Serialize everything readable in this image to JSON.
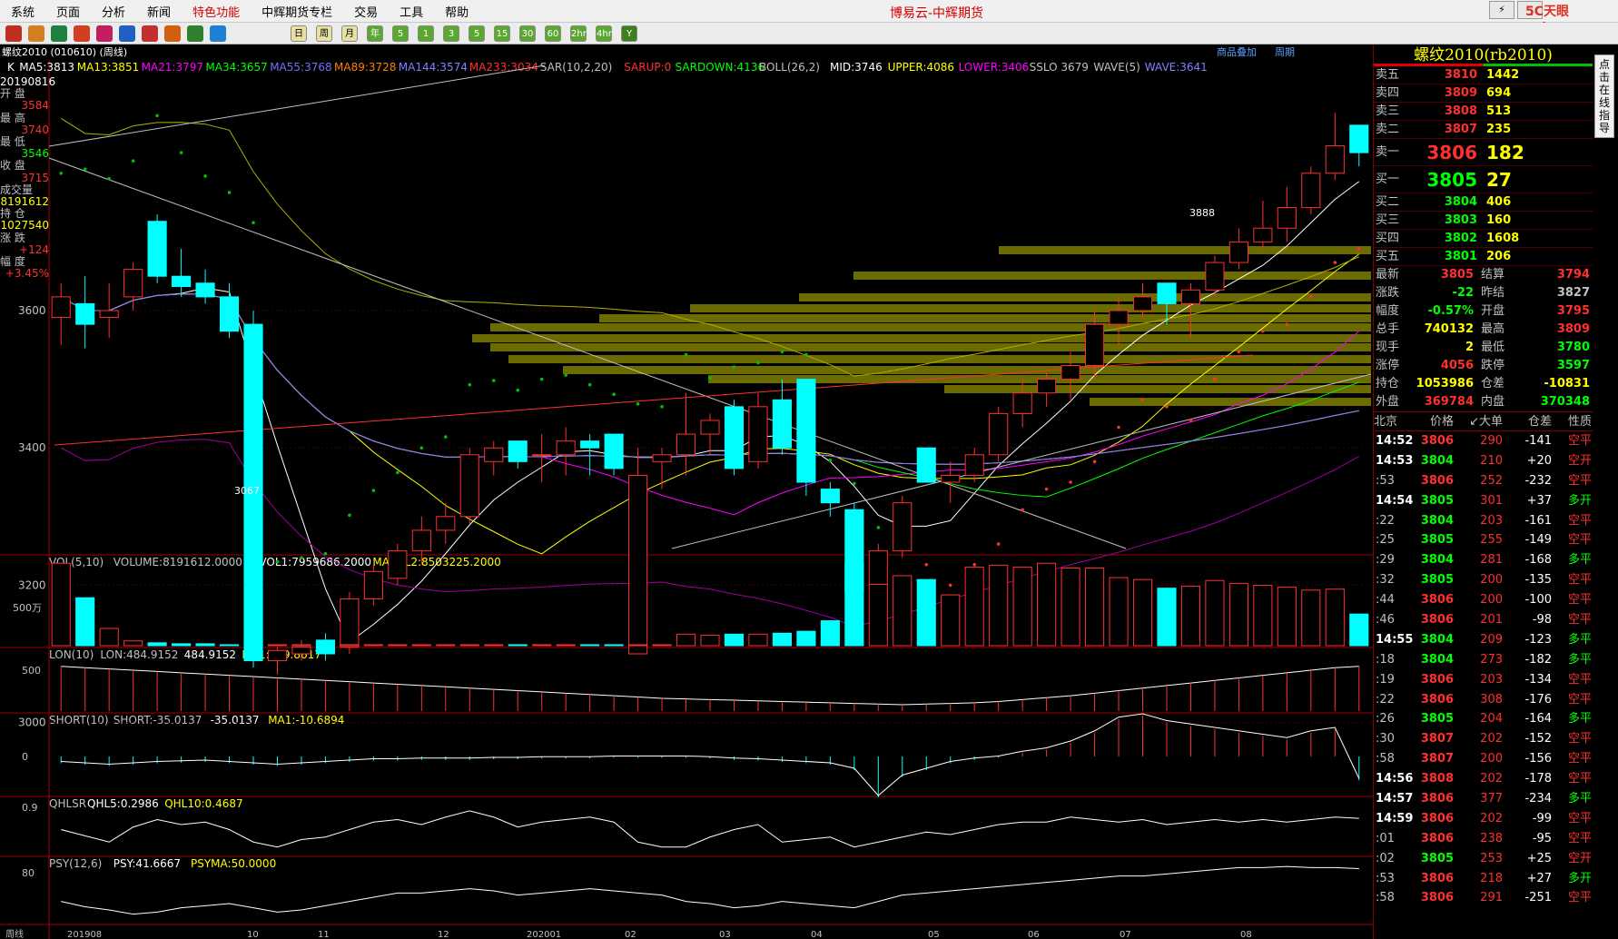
{
  "menubar": {
    "items": [
      "系统",
      "页面",
      "分析",
      "新闻",
      "特色功能",
      "中辉期货专栏",
      "交易",
      "工具",
      "帮助"
    ],
    "highlight_index": 4,
    "title": "博易云-中辉期货",
    "logo": "5C天眼 setz.com"
  },
  "toolbar": {
    "period_icons": [
      "日",
      "周",
      "月",
      "年",
      "5",
      "1",
      "3",
      "5",
      "15",
      "30",
      "60",
      "2hr",
      "4hr",
      "Y"
    ]
  },
  "tabline": "螺纹2010 (010610) (周线)",
  "subheader_right": [
    "商品叠加",
    "周期"
  ],
  "info": {
    "date": "20190816",
    "open_label": "开  盘",
    "open": "3584",
    "high_label": "最  高",
    "high": "3740",
    "low_label": "最  低",
    "low": "3546",
    "close_label": "收  盘",
    "close": "3715",
    "vol_label": "成交量",
    "vol": "8191612",
    "oi_label": "持  仓",
    "oi": "1027540",
    "chg_label": "涨  跌",
    "chg": "+124",
    "pct_label": "幅  度",
    "pct": "+3.45%"
  },
  "indicators": {
    "main": [
      {
        "t": "K",
        "c": "#ffffff"
      },
      {
        "t": "MA5:3813",
        "c": "#ffffff"
      },
      {
        "t": "MA13:3851",
        "c": "#ffff00"
      },
      {
        "t": "MA21:3797",
        "c": "#ff00ff"
      },
      {
        "t": "MA34:3657",
        "c": "#00ff00"
      },
      {
        "t": "MA55:3768",
        "c": "#7070ff"
      },
      {
        "t": "MA89:3728",
        "c": "#ff8000"
      },
      {
        "t": "MA144:3574",
        "c": "#8080ff"
      },
      {
        "t": "MA233:3034",
        "c": "#ff3030"
      },
      {
        "t": "SAR(10,2,20)",
        "c": "#c0c0c0"
      },
      {
        "t": "SARUP:0",
        "c": "#ff3030"
      },
      {
        "t": "SARDOWN:4136",
        "c": "#00ff00"
      },
      {
        "t": "BOLL(26,2)",
        "c": "#c0c0c0"
      },
      {
        "t": "MID:3746",
        "c": "#ffffff"
      },
      {
        "t": "UPPER:4086",
        "c": "#ffff00"
      },
      {
        "t": "LOWER:3406",
        "c": "#ff00ff"
      },
      {
        "t": "SSLO 3679",
        "c": "#c0c0c0"
      },
      {
        "t": "WAVE(5)",
        "c": "#c0c0c0"
      },
      {
        "t": "WAVE:3641",
        "c": "#8080ff"
      }
    ],
    "vol": [
      {
        "t": "VOL(5,10)",
        "c": "#c0c0c0"
      },
      {
        "t": "VOLUME:8191612.0000",
        "c": "#c0c0c0"
      },
      {
        "t": "MAVOL1:7959686.2000",
        "c": "#ffffff"
      },
      {
        "t": "MAVOL2:8503225.2000",
        "c": "#ffff00"
      }
    ],
    "lon": [
      {
        "t": "LON(10)",
        "c": "#c0c0c0"
      },
      {
        "t": "LON:484.9152",
        "c": "#c0c0c0"
      },
      {
        "t": "484.9152",
        "c": "#ffffff"
      },
      {
        "t": "MA1:589.8617",
        "c": "#ffff00"
      }
    ],
    "short": [
      {
        "t": "SHORT(10)",
        "c": "#c0c0c0"
      },
      {
        "t": "SHORT:-35.0137",
        "c": "#c0c0c0"
      },
      {
        "t": "-35.0137",
        "c": "#ffffff"
      },
      {
        "t": "MA1:-10.6894",
        "c": "#ffff00"
      }
    ],
    "qhl": [
      {
        "t": "QHLSR",
        "c": "#c0c0c0"
      },
      {
        "t": "QHL5:0.2986",
        "c": "#ffffff"
      },
      {
        "t": "QHL10:0.4687",
        "c": "#ffff00"
      }
    ],
    "psy": [
      {
        "t": "PSY(12,6)",
        "c": "#c0c0c0"
      },
      {
        "t": "PSY:41.6667",
        "c": "#ffffff"
      },
      {
        "t": "PSYMA:50.0000",
        "c": "#ffff00"
      }
    ]
  },
  "axis": {
    "price_ticks": [
      "3600",
      "3400",
      "3200",
      "3000"
    ],
    "vol_tick": "500万",
    "lon_tick": "500",
    "short_tick": "0",
    "qhl_tick": "0.9",
    "psy_tick": "80",
    "x_labels": [
      "201908",
      "10",
      "11",
      "12",
      "202001",
      "02",
      "03",
      "04",
      "05",
      "06",
      "07",
      "08"
    ],
    "period_label": "周线"
  },
  "chart_annotations": {
    "high_marker": "3888",
    "low_marker": "3067"
  },
  "chart_data": {
    "type": "candlestick",
    "series": "螺纹2010 weekly",
    "candles": [
      [
        3590,
        3640,
        3550,
        3620
      ],
      [
        3610,
        3650,
        3545,
        3580
      ],
      [
        3590,
        3640,
        3560,
        3600
      ],
      [
        3620,
        3670,
        3600,
        3660
      ],
      [
        3730,
        3740,
        3640,
        3650
      ],
      [
        3650,
        3690,
        3620,
        3635
      ],
      [
        3640,
        3660,
        3610,
        3620
      ],
      [
        3620,
        3640,
        3560,
        3570
      ],
      [
        3580,
        3600,
        3080,
        3090
      ],
      [
        3090,
        3110,
        3070,
        3105
      ],
      [
        3100,
        3120,
        3090,
        3110
      ],
      [
        3120,
        3130,
        3090,
        3100
      ],
      [
        3110,
        3190,
        3100,
        3180
      ],
      [
        3180,
        3230,
        3170,
        3220
      ],
      [
        3210,
        3260,
        3200,
        3250
      ],
      [
        3250,
        3300,
        3230,
        3280
      ],
      [
        3280,
        3320,
        3260,
        3300
      ],
      [
        3300,
        3400,
        3290,
        3390
      ],
      [
        3380,
        3410,
        3360,
        3400
      ],
      [
        3410,
        3400,
        3370,
        3380
      ],
      [
        3390,
        3420,
        3350,
        3390
      ],
      [
        3390,
        3430,
        3360,
        3410
      ],
      [
        3410,
        3420,
        3360,
        3400
      ],
      [
        3420,
        3410,
        3360,
        3370
      ],
      [
        3100,
        3400,
        3100,
        3360
      ],
      [
        3380,
        3400,
        3340,
        3390
      ],
      [
        3390,
        3480,
        3360,
        3420
      ],
      [
        3420,
        3450,
        3390,
        3440
      ],
      [
        3460,
        3470,
        3360,
        3370
      ],
      [
        3380,
        3480,
        3370,
        3460
      ],
      [
        3470,
        3500,
        3390,
        3400
      ],
      [
        3500,
        3500,
        3330,
        3350
      ],
      [
        3340,
        3350,
        3300,
        3320
      ],
      [
        3310,
        3320,
        3150,
        3190
      ],
      [
        3200,
        3260,
        3190,
        3250
      ],
      [
        3250,
        3330,
        3240,
        3320
      ],
      [
        3400,
        3400,
        3350,
        3350
      ],
      [
        3350,
        3380,
        3320,
        3360
      ],
      [
        3360,
        3400,
        3350,
        3390
      ],
      [
        3390,
        3460,
        3380,
        3450
      ],
      [
        3450,
        3500,
        3430,
        3480
      ],
      [
        3480,
        3510,
        3460,
        3500
      ],
      [
        3500,
        3540,
        3470,
        3520
      ],
      [
        3520,
        3600,
        3500,
        3580
      ],
      [
        3580,
        3620,
        3550,
        3600
      ],
      [
        3600,
        3640,
        3590,
        3620
      ],
      [
        3640,
        3620,
        3580,
        3610
      ],
      [
        3610,
        3640,
        3560,
        3630
      ],
      [
        3630,
        3680,
        3620,
        3670
      ],
      [
        3670,
        3720,
        3660,
        3700
      ],
      [
        3700,
        3760,
        3690,
        3720
      ],
      [
        3720,
        3780,
        3700,
        3750
      ],
      [
        3750,
        3810,
        3740,
        3800
      ],
      [
        3800,
        3888,
        3790,
        3840
      ],
      [
        3870,
        3860,
        3810,
        3830
      ]
    ],
    "volumes": [
      8.6,
      5.0,
      1.8,
      0.5,
      0.3,
      0.2,
      0.2,
      0.1,
      0.1,
      0.1,
      0.1,
      0.1,
      0.1,
      0.1,
      0.1,
      0.1,
      0.1,
      0.1,
      0.1,
      0.1,
      0.1,
      0.1,
      0.1,
      0.1,
      0.1,
      0.1,
      1.2,
      1.1,
      1.2,
      1.2,
      1.3,
      1.5,
      2.6,
      8.5,
      6.4,
      7.3,
      6.9,
      5.3,
      8.2,
      8.4,
      8.2,
      8.6,
      8.1,
      8.1,
      7.1,
      6.9,
      6.0,
      6.2,
      6.8,
      6.5,
      6.3,
      6.1,
      5.8,
      5.9,
      3.3
    ],
    "lon": [
      500,
      490,
      480,
      470,
      460,
      450,
      440,
      430,
      420,
      410,
      400,
      390,
      380,
      370,
      360,
      350,
      340,
      330,
      320,
      310,
      300,
      290,
      280,
      270,
      260,
      250,
      245,
      240,
      235,
      230,
      225,
      220,
      215,
      210,
      205,
      200,
      205,
      210,
      215,
      225,
      240,
      255,
      270,
      290,
      310,
      330,
      350,
      370,
      390,
      410,
      430,
      450,
      470,
      490,
      500
    ],
    "short": [
      -10,
      -12,
      -14,
      -12,
      -10,
      -9,
      -8,
      -10,
      -12,
      -14,
      -12,
      -10,
      -8,
      -6,
      -6,
      -5,
      -5,
      -5,
      -4,
      -4,
      -3,
      -3,
      -3,
      -2,
      -2,
      -2,
      -2,
      -3,
      -5,
      -6,
      -8,
      -10,
      -12,
      -20,
      -60,
      -30,
      -20,
      -10,
      -5,
      -2,
      5,
      10,
      20,
      35,
      55,
      60,
      50,
      45,
      40,
      35,
      30,
      25,
      35,
      40,
      -35
    ],
    "qhl": [
      0.8,
      0.75,
      0.7,
      0.82,
      0.88,
      0.84,
      0.86,
      0.8,
      0.7,
      0.66,
      0.72,
      0.74,
      0.8,
      0.86,
      0.88,
      0.84,
      0.9,
      0.95,
      0.9,
      0.82,
      0.86,
      0.88,
      0.9,
      0.86,
      0.7,
      0.66,
      0.66,
      0.74,
      0.8,
      0.84,
      0.7,
      0.72,
      0.74,
      0.66,
      0.7,
      0.74,
      0.78,
      0.76,
      0.8,
      0.84,
      0.86,
      0.86,
      0.9,
      0.88,
      0.86,
      0.88,
      0.84,
      0.86,
      0.88,
      0.86,
      0.88,
      0.86,
      0.88,
      0.9,
      0.89
    ],
    "psy": [
      50,
      45,
      42,
      38,
      40,
      44,
      46,
      48,
      44,
      40,
      42,
      46,
      50,
      54,
      58,
      58,
      60,
      62,
      60,
      56,
      58,
      60,
      62,
      60,
      58,
      56,
      50,
      48,
      44,
      46,
      50,
      48,
      46,
      44,
      50,
      56,
      58,
      60,
      62,
      64,
      66,
      68,
      70,
      72,
      74,
      74,
      76,
      78,
      80,
      82,
      82,
      83,
      82,
      82,
      81
    ]
  },
  "quote": {
    "title": "螺纹2010(rb2010)",
    "asks": [
      {
        "label": "卖五",
        "price": "3810",
        "vol": "1442"
      },
      {
        "label": "卖四",
        "price": "3809",
        "vol": "694"
      },
      {
        "label": "卖三",
        "price": "3808",
        "vol": "513"
      },
      {
        "label": "卖二",
        "price": "3807",
        "vol": "235"
      },
      {
        "label": "卖一",
        "price": "3806",
        "vol": "182"
      }
    ],
    "bids": [
      {
        "label": "买一",
        "price": "3805",
        "vol": "27"
      },
      {
        "label": "买二",
        "price": "3804",
        "vol": "406"
      },
      {
        "label": "买三",
        "price": "3803",
        "vol": "160"
      },
      {
        "label": "买四",
        "price": "3802",
        "vol": "1608"
      },
      {
        "label": "买五",
        "price": "3801",
        "vol": "206"
      }
    ],
    "stats": [
      [
        "最新",
        "3805",
        "#ff3030",
        "结算",
        "3794",
        "#ff3030"
      ],
      [
        "涨跌",
        "-22",
        "#00ff00",
        "昨结",
        "3827",
        "#c0c0c0"
      ],
      [
        "幅度",
        "-0.57%",
        "#00ff00",
        "开盘",
        "3795",
        "#ff3030"
      ],
      [
        "总手",
        "740132",
        "#ffff00",
        "最高",
        "3809",
        "#ff3030"
      ],
      [
        "现手",
        "2",
        "#ffff00",
        "最低",
        "3780",
        "#00ff00"
      ],
      [
        "涨停",
        "4056",
        "#ff3030",
        "跌停",
        "3597",
        "#00ff00"
      ],
      [
        "持仓",
        "1053986",
        "#ffff00",
        "仓差",
        "-10831",
        "#ffff00"
      ],
      [
        "外盘",
        "369784",
        "#ff3030",
        "内盘",
        "370348",
        "#00ff00"
      ]
    ],
    "trade_header": [
      "北京",
      "价格",
      "↙大单",
      "仓差",
      "性质"
    ],
    "trades": [
      [
        "14:52",
        "3806",
        "290",
        "-141",
        "空平",
        1
      ],
      [
        "14:53",
        "3804",
        "210",
        "+20",
        "空开",
        1
      ],
      [
        ":53",
        "3806",
        "252",
        "-232",
        "空平",
        0
      ],
      [
        "14:54",
        "3805",
        "301",
        "+37",
        "多开",
        1
      ],
      [
        ":22",
        "3804",
        "203",
        "-161",
        "空平",
        0
      ],
      [
        ":25",
        "3805",
        "255",
        "-149",
        "空平",
        0
      ],
      [
        ":29",
        "3804",
        "281",
        "-168",
        "多平",
        0
      ],
      [
        ":32",
        "3805",
        "200",
        "-135",
        "空平",
        0
      ],
      [
        ":44",
        "3806",
        "200",
        "-100",
        "空平",
        0
      ],
      [
        ":46",
        "3806",
        "201",
        "-98",
        "空平",
        0
      ],
      [
        "14:55",
        "3804",
        "209",
        "-123",
        "多平",
        1
      ],
      [
        ":18",
        "3804",
        "273",
        "-182",
        "多平",
        0
      ],
      [
        ":19",
        "3806",
        "203",
        "-134",
        "空平",
        0
      ],
      [
        ":22",
        "3806",
        "308",
        "-176",
        "空平",
        0
      ],
      [
        ":26",
        "3805",
        "204",
        "-164",
        "多平",
        0
      ],
      [
        ":30",
        "3807",
        "202",
        "-152",
        "空平",
        0
      ],
      [
        ":58",
        "3807",
        "200",
        "-156",
        "空平",
        0
      ],
      [
        "14:56",
        "3808",
        "202",
        "-178",
        "空平",
        1
      ],
      [
        "14:57",
        "3806",
        "377",
        "-234",
        "多平",
        1
      ],
      [
        "14:59",
        "3806",
        "202",
        "-99",
        "空平",
        1
      ],
      [
        ":01",
        "3806",
        "238",
        "-95",
        "空平",
        0
      ],
      [
        ":02",
        "3805",
        "253",
        "+25",
        "空开",
        0
      ],
      [
        ":53",
        "3806",
        "218",
        "+27",
        "多开",
        0
      ],
      [
        ":58",
        "3806",
        "291",
        "-251",
        "空平",
        0
      ]
    ]
  },
  "sidetab": "点击在线指导"
}
